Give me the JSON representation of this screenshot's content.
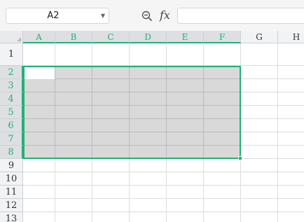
{
  "formula_bar": {
    "name_box": "A2",
    "fx_label": "fx",
    "formula": ""
  },
  "columns": [
    "A",
    "B",
    "C",
    "D",
    "E",
    "F",
    "G",
    "H"
  ],
  "rows": [
    "1",
    "2",
    "3",
    "4",
    "5",
    "6",
    "7",
    "8",
    "9",
    "10",
    "11",
    "12",
    "13"
  ],
  "selection": {
    "range": "A2:F8",
    "active_cell": "A2"
  },
  "colors": {
    "accent": "#20b177",
    "selection_fill": "#d9d9d9"
  },
  "icons": [
    "zoom-icon",
    "fx-icon",
    "chevron-down-icon"
  ]
}
